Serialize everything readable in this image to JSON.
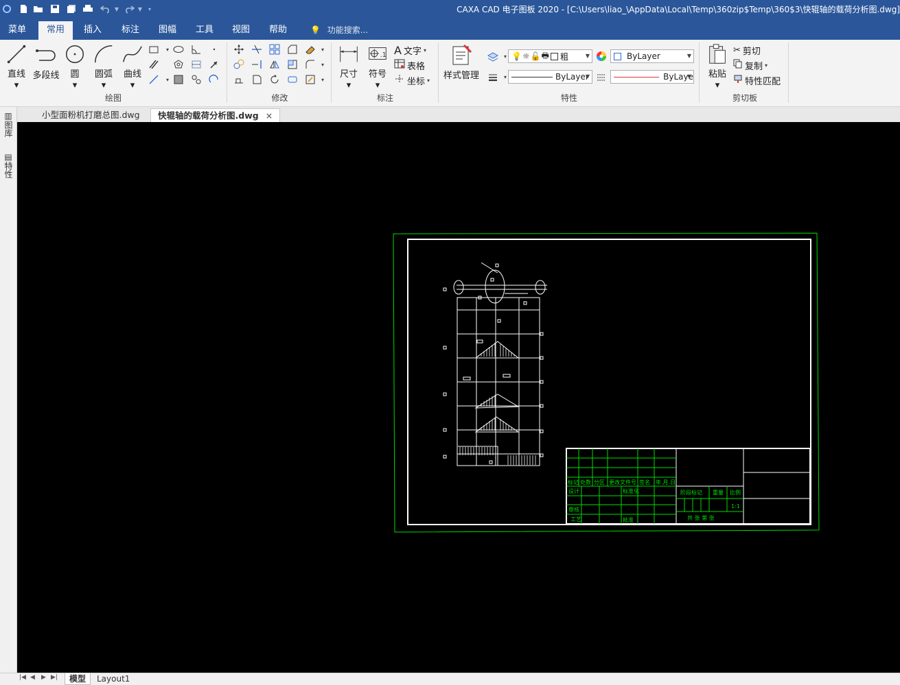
{
  "window": {
    "title": "CAXA CAD 电子图板 2020 - [C:\\Users\\liao_\\AppData\\Local\\Temp\\360zip$Temp\\360$3\\快辊轴的载荷分析图.dwg]"
  },
  "menu": {
    "tabs": [
      "菜单",
      "常用",
      "插入",
      "标注",
      "图幅",
      "工具",
      "视图",
      "帮助"
    ],
    "search_placeholder": "功能搜索..."
  },
  "ribbon": {
    "draw": {
      "label": "绘图",
      "buttons": [
        "直线",
        "多段线",
        "圆",
        "圆弧",
        "曲线"
      ]
    },
    "modify": {
      "label": "修改"
    },
    "annotate": {
      "label": "标注",
      "buttons": [
        "尺寸",
        "符号"
      ],
      "items": [
        "文字",
        "表格",
        "坐标"
      ]
    },
    "properties": {
      "label": "特性",
      "style_manager": "样式管理",
      "linewidth": "粗",
      "layer": "ByLayer",
      "linetype": "ByLayer",
      "color": "ByLaye"
    },
    "clipboard": {
      "label": "剪切板",
      "paste": "粘贴",
      "items": [
        "剪切",
        "复制",
        "特性匹配"
      ]
    }
  },
  "doc_tabs": [
    {
      "label": "小型面粉机打磨总图.dwg",
      "active": false
    },
    {
      "label": "快辊轴的载荷分析图.dwg",
      "active": true
    }
  ],
  "sidebar": {
    "tabs": [
      "图库",
      "特性"
    ]
  },
  "title_block": {
    "row_headers": [
      "标记",
      "处数",
      "分区",
      "更改文件号",
      "签名",
      "年.月.日"
    ],
    "left_labels": [
      "设计",
      "标准化",
      "审核",
      "工艺",
      "批准"
    ],
    "right_labels": [
      "阶段标记",
      "重量",
      "比例"
    ],
    "sheet_text": "共    张 第    张",
    "scale_value": "1:1"
  },
  "layout_tabs": [
    "模型",
    "Layout1"
  ],
  "colors": {
    "accent": "#2b579a",
    "canvas": "#000000",
    "frame_green": "#00dd00"
  }
}
